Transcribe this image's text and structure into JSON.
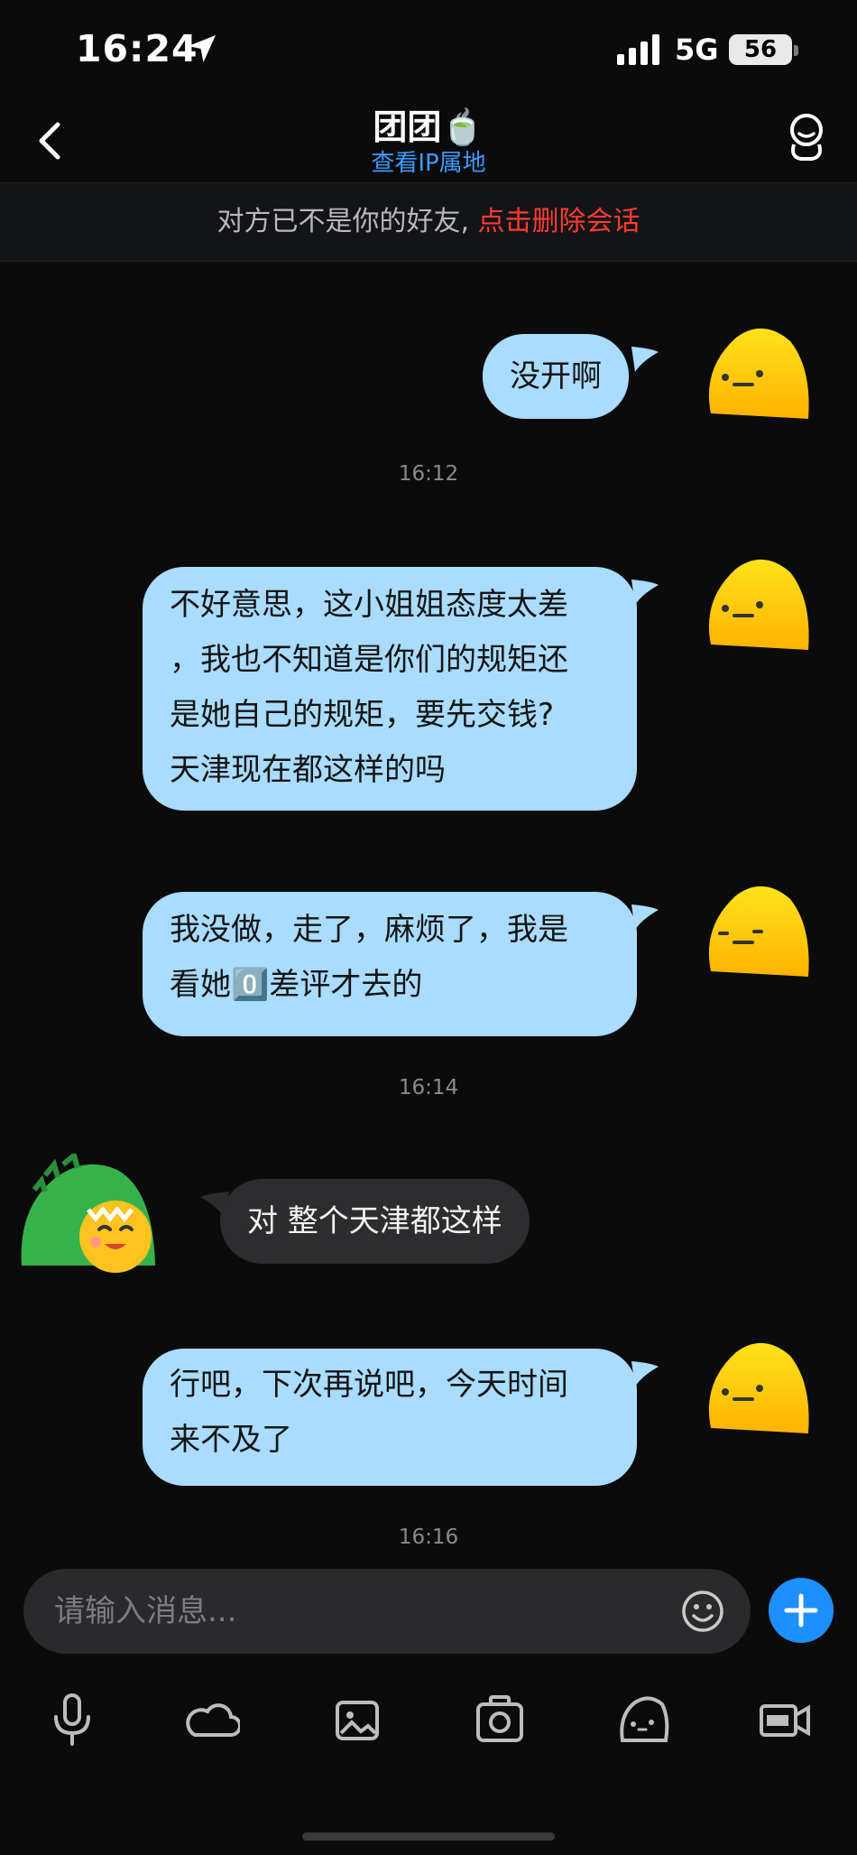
{
  "status_bar": {
    "time": "16:24",
    "network": "5G",
    "battery": "56"
  },
  "header": {
    "title": "团团🍵",
    "subtitle": "查看IP属地"
  },
  "notice": {
    "text": "对方已不是你的好友, ",
    "action": "点击删除会话"
  },
  "messages": [
    {
      "from": "me",
      "lines": [
        "没开啊"
      ]
    },
    {
      "type": "time",
      "text": "16:12"
    },
    {
      "from": "me",
      "lines": [
        "不好意思，这小姐姐态度太差",
        "，我也不知道是你们的规矩还",
        "是她自己的规矩，要先交钱?",
        "天津现在都这样的吗"
      ]
    },
    {
      "from": "me",
      "lines": [
        "我没做，走了，麻烦了，我是",
        "看她0️⃣差评才去的"
      ]
    },
    {
      "type": "time",
      "text": "16:14"
    },
    {
      "from": "them",
      "lines": [
        "对 整个天津都这样"
      ]
    },
    {
      "from": "me",
      "lines": [
        "行吧，下次再说吧，今天时间",
        "来不及了"
      ]
    },
    {
      "type": "time",
      "text": "16:16"
    }
  ],
  "input": {
    "placeholder": "请输入消息..."
  },
  "toolbar": [
    "mic-icon",
    "cloud-icon",
    "image-icon",
    "camera-icon",
    "sticker-icon",
    "gif-video-icon"
  ],
  "colors": {
    "bubble_out": "#a9dcff",
    "bubble_in": "#2d2d2f",
    "accent": "#1e8fff",
    "danger": "#ff3b30"
  }
}
